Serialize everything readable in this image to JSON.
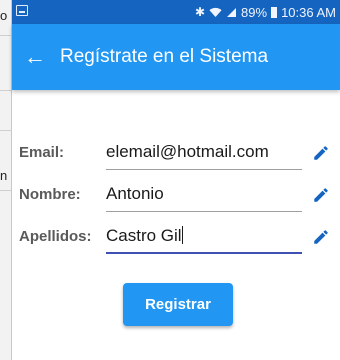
{
  "left_strip": {
    "top_fragment": "o",
    "mid_fragment": "n"
  },
  "status_bar": {
    "battery_percent": "89%",
    "time": "10:36 AM",
    "icons": [
      "bluetooth-icon",
      "wifi-icon",
      "signal-icon",
      "battery-icon"
    ]
  },
  "app_bar": {
    "back_icon": "arrow-left-icon",
    "title": "Regístrate en el Sistema",
    "background": "#2196f3"
  },
  "form": {
    "fields": [
      {
        "label": "Email:",
        "value": "elemail@hotmail.com",
        "focused": false
      },
      {
        "label": "Nombre:",
        "value": "Antonio",
        "focused": false
      },
      {
        "label": "Apellidos:",
        "value": "Castro Gil",
        "focused": true
      }
    ],
    "edit_icon": "pencil-icon",
    "edit_icon_color": "#1565c0"
  },
  "register_button": {
    "label": "Registrar",
    "color": "#2196f3"
  }
}
